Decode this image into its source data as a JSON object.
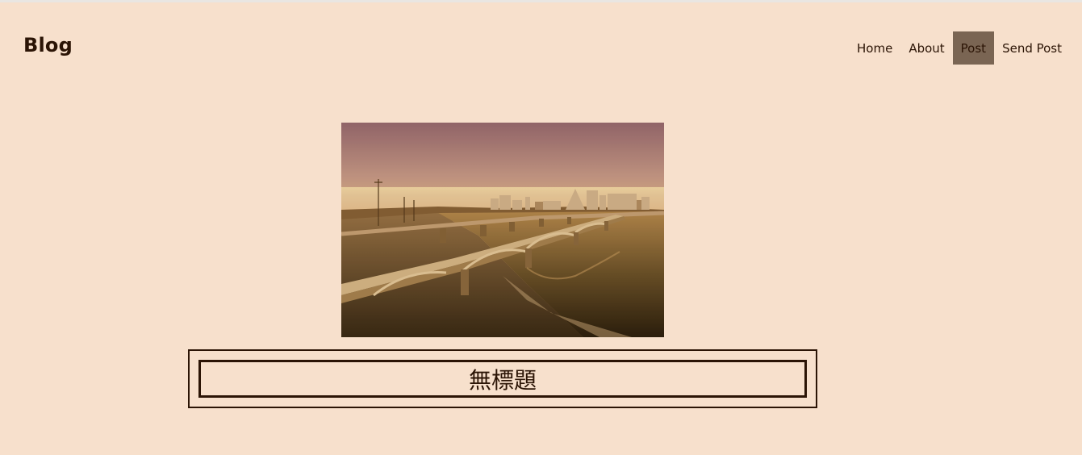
{
  "header": {
    "brand": "Blog",
    "nav": [
      {
        "label": "Home",
        "active": false
      },
      {
        "label": "About",
        "active": false
      },
      {
        "label": "Post",
        "active": true
      },
      {
        "label": "Send Post",
        "active": false
      }
    ]
  },
  "post": {
    "title": "無標題"
  },
  "colors": {
    "background": "#f7e0cc",
    "text": "#2b1405",
    "nav_active": "#7a6553"
  }
}
